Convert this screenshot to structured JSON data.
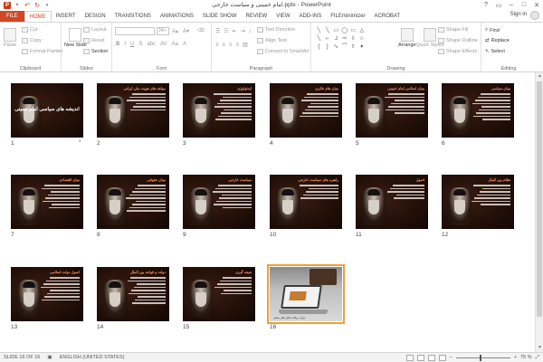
{
  "window": {
    "title": "امام خمینی و سیاست خارجی.pptx - PowerPoint",
    "controls": [
      "?",
      "▭",
      "–",
      "□",
      "✕"
    ]
  },
  "qat": {
    "app_icon": "P",
    "save_icon": "save-icon",
    "undo_icon": "undo-icon",
    "redo_icon": "redo-icon",
    "customize_icon": "customize-icon"
  },
  "tabs": [
    "FILE",
    "HOME",
    "INSERT",
    "DESIGN",
    "TRANSITIONS",
    "ANIMATIONS",
    "SLIDE SHOW",
    "REVIEW",
    "VIEW",
    "ADD-INS",
    "FILEminimizer",
    "ACROBAT"
  ],
  "active_tab": "HOME",
  "signin": "Sign in",
  "ribbon": {
    "clipboard": {
      "label": "Clipboard",
      "paste": "Paste",
      "cut": "Cut",
      "copy": "Copy",
      "format_painter": "Format Painter"
    },
    "slides": {
      "label": "Slides",
      "new_slide": "New Slide",
      "layout": "Layout",
      "reset": "Reset",
      "section": "Section"
    },
    "font": {
      "label": "Font",
      "size": "24+"
    },
    "paragraph": {
      "label": "Paragraph",
      "text_direction": "Text Direction",
      "align_text": "Align Text",
      "convert": "Convert to SmartArt"
    },
    "drawing": {
      "label": "Drawing",
      "arrange": "Arrange",
      "quick_styles": "Quick Styles",
      "shape_fill": "Shape Fill",
      "shape_outline": "Shape Outline",
      "shape_effects": "Shape Effects"
    },
    "editing": {
      "label": "Editing",
      "find": "Find",
      "replace": "Replace",
      "select": "Select"
    }
  },
  "slides": [
    {
      "num": "1",
      "title": "اندیشه های سیاسی امام خمینی",
      "lines": 0,
      "type": "title"
    },
    {
      "num": "2",
      "title": "مولفه های هویت ملی ایرانی",
      "lines": 6,
      "type": "text"
    },
    {
      "num": "3",
      "title": "ایدئولوژی",
      "lines": 9,
      "type": "text"
    },
    {
      "num": "4",
      "title": "بنیان های فکری",
      "lines": 8,
      "type": "text"
    },
    {
      "num": "5",
      "title": "بنیان اسلامی امام خمینی",
      "lines": 7,
      "type": "text"
    },
    {
      "num": "6",
      "title": "بنیان سیاسی",
      "lines": 9,
      "type": "text"
    },
    {
      "num": "7",
      "title": "بنیان اقتصادی",
      "lines": 8,
      "type": "text"
    },
    {
      "num": "8",
      "title": "بنیان حقوقی",
      "lines": 9,
      "type": "text"
    },
    {
      "num": "9",
      "title": "سیاست خارجی",
      "lines": 8,
      "type": "text"
    },
    {
      "num": "10",
      "title": "راهبرد های سیاست خارجی",
      "lines": 5,
      "type": "text"
    },
    {
      "num": "11",
      "title": "اصول",
      "lines": 5,
      "type": "text"
    },
    {
      "num": "12",
      "title": "نظام بین الملل",
      "lines": 7,
      "type": "text"
    },
    {
      "num": "13",
      "title": "اصول دولت اسلامی",
      "lines": 8,
      "type": "text"
    },
    {
      "num": "14",
      "title": "دولت و قواعد بین الملل",
      "lines": 9,
      "type": "text"
    },
    {
      "num": "15",
      "title": "نتیجه گیری",
      "lines": 6,
      "type": "text"
    },
    {
      "num": "16",
      "title": "",
      "lines": 0,
      "type": "photo"
    }
  ],
  "slide1_star": "*",
  "slide16_text": "برای دریافت فایل های بیشتر",
  "status": {
    "slide_of": "SLIDE 16 OF 16",
    "language": "ENGLISH (UNITED STATES)",
    "zoom": "75 %",
    "zoom_level": 0.45
  },
  "colors": {
    "accent": "#d24726",
    "selection": "#f0a030"
  }
}
